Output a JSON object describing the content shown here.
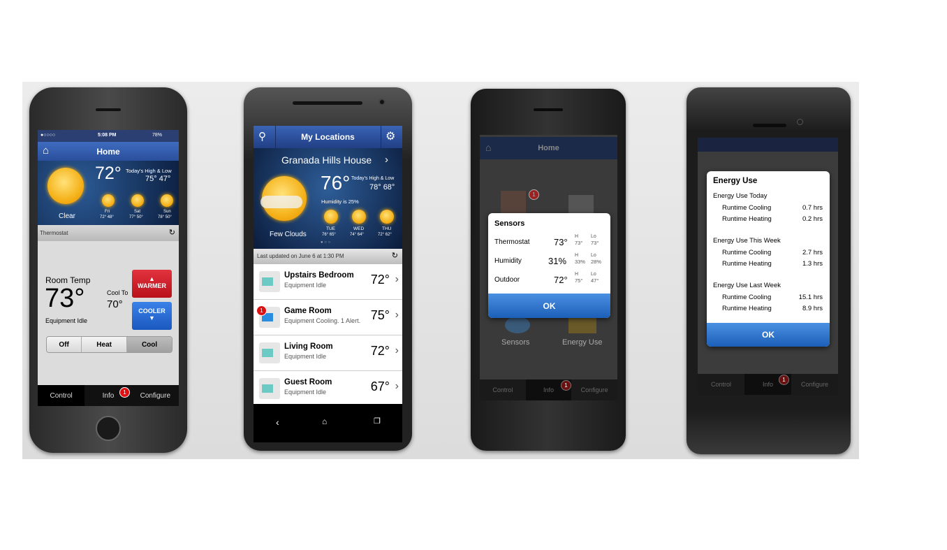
{
  "phone1": {
    "status": {
      "time": "5:08 PM",
      "battery": "78%"
    },
    "header": {
      "title": "Home"
    },
    "weather": {
      "current": "72°",
      "condition": "Clear",
      "hl_label": "Today's High & Low",
      "hl": "75° 47°",
      "forecast": [
        {
          "day": "Fri",
          "temps": "72° 48°"
        },
        {
          "day": "Sat",
          "temps": "77° 50°"
        },
        {
          "day": "Sun",
          "temps": "78° 50°"
        }
      ]
    },
    "section": "Thermostat",
    "room_label": "Room Temp",
    "room_temp": "73°",
    "equipment": "Equipment Idle",
    "cool_to_label": "Cool To",
    "cool_to": "70°",
    "warmer": "WARMER",
    "cooler": "COOLER",
    "modes": [
      "Off",
      "Heat",
      "Cool"
    ],
    "active_mode": "Cool",
    "tabs": [
      "Control",
      "Info",
      "Configure"
    ],
    "info_badge": "1"
  },
  "phone2": {
    "header": {
      "title": "My Locations"
    },
    "location": "Granada Hills House",
    "weather": {
      "current": "76°",
      "hl_label": "Today's High & Low",
      "hl": "78° 68°",
      "humidity": "Humidity is 25%",
      "condition": "Few Clouds",
      "forecast": [
        {
          "day": "TUE",
          "temps": "76° 65°"
        },
        {
          "day": "WED",
          "temps": "74° 64°"
        },
        {
          "day": "THU",
          "temps": "72° 62°"
        }
      ]
    },
    "updated": "Last updated on June 6 at 1:30 PM",
    "rooms": [
      {
        "name": "Upstairs Bedroom",
        "status": "Equipment Idle",
        "temp": "72°"
      },
      {
        "name": "Game Room",
        "status": "Equipment Cooling. 1 Alert.",
        "temp": "75°",
        "badge": "1"
      },
      {
        "name": "Living Room",
        "status": "Equipment Idle",
        "temp": "72°"
      },
      {
        "name": "Guest Room",
        "status": "Equipment Idle",
        "temp": "67°"
      }
    ]
  },
  "phone3": {
    "header": {
      "title": "Home"
    },
    "icons": [
      "Sensors",
      "Energy Use"
    ],
    "tabs": [
      "Control",
      "Info",
      "Configure"
    ],
    "info_badge": "1",
    "icon_badge": "1",
    "dialog": {
      "title": "Sensors",
      "hi_label": "H",
      "lo_label": "Lo",
      "rows": [
        {
          "label": "Thermostat",
          "value": "73°",
          "hi": "73°",
          "lo": "73°"
        },
        {
          "label": "Humidity",
          "value": "31%",
          "hi": "33%",
          "lo": "28%"
        },
        {
          "label": "Outdoor",
          "value": "72°",
          "hi": "75°",
          "lo": "47°"
        }
      ],
      "ok": "OK"
    }
  },
  "phone4": {
    "tabs": [
      "Control",
      "Info",
      "Configure"
    ],
    "info_badge": "1",
    "dialog": {
      "title": "Energy Use",
      "groups": [
        {
          "label": "Energy Use Today",
          "rows": [
            {
              "label": "Runtime Cooling",
              "value": "0.7 hrs"
            },
            {
              "label": "Runtime Heating",
              "value": "0.2 hrs"
            }
          ]
        },
        {
          "label": "Energy Use This Week",
          "rows": [
            {
              "label": "Runtime Cooling",
              "value": "2.7 hrs"
            },
            {
              "label": "Runtime Heating",
              "value": "1.3 hrs"
            }
          ]
        },
        {
          "label": "Energy Use Last Week",
          "rows": [
            {
              "label": "Runtime Cooling",
              "value": "15.1 hrs"
            },
            {
              "label": "Runtime Heating",
              "value": "8.9 hrs"
            }
          ]
        }
      ],
      "ok": "OK"
    }
  },
  "colors": {
    "header_blue": "#2f57a8",
    "warmer_red": "#d0202e",
    "cooler_blue": "#2a6fd6",
    "ok_blue": "#2a74d0",
    "badge_red": "#d11"
  }
}
